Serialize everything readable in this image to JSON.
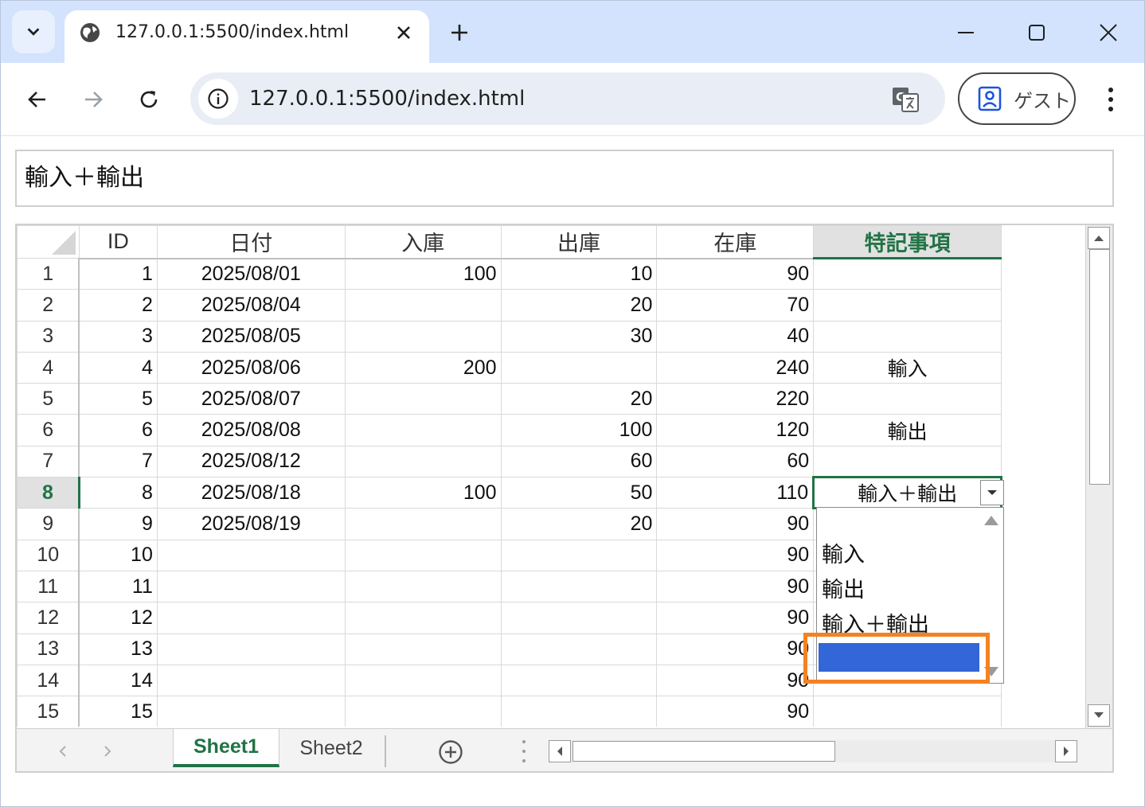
{
  "browser": {
    "tab_title": "127.0.0.1:5500/index.html",
    "url": "127.0.0.1:5500/index.html",
    "profile_label": "ゲスト"
  },
  "formula_bar": {
    "value": "輸入＋輸出"
  },
  "sheet": {
    "columns": [
      "ID",
      "日付",
      "入庫",
      "出庫",
      "在庫",
      "特記事項"
    ],
    "active_column": "特記事項",
    "active_row": "8",
    "rows": [
      {
        "row": "1",
        "id": "1",
        "date": "2025/08/01",
        "in": "100",
        "out": "10",
        "stock": "90",
        "note": ""
      },
      {
        "row": "2",
        "id": "2",
        "date": "2025/08/04",
        "in": "",
        "out": "20",
        "stock": "70",
        "note": ""
      },
      {
        "row": "3",
        "id": "3",
        "date": "2025/08/05",
        "in": "",
        "out": "30",
        "stock": "40",
        "note": ""
      },
      {
        "row": "4",
        "id": "4",
        "date": "2025/08/06",
        "in": "200",
        "out": "",
        "stock": "240",
        "note": "輸入"
      },
      {
        "row": "5",
        "id": "5",
        "date": "2025/08/07",
        "in": "",
        "out": "20",
        "stock": "220",
        "note": ""
      },
      {
        "row": "6",
        "id": "6",
        "date": "2025/08/08",
        "in": "",
        "out": "100",
        "stock": "120",
        "note": "輸出"
      },
      {
        "row": "7",
        "id": "7",
        "date": "2025/08/12",
        "in": "",
        "out": "60",
        "stock": "60",
        "note": ""
      },
      {
        "row": "8",
        "id": "8",
        "date": "2025/08/18",
        "in": "100",
        "out": "50",
        "stock": "110",
        "note": "輸入＋輸出"
      },
      {
        "row": "9",
        "id": "9",
        "date": "2025/08/19",
        "in": "",
        "out": "20",
        "stock": "90",
        "note": ""
      },
      {
        "row": "10",
        "id": "10",
        "date": "",
        "in": "",
        "out": "",
        "stock": "90",
        "note": ""
      },
      {
        "row": "11",
        "id": "11",
        "date": "",
        "in": "",
        "out": "",
        "stock": "90",
        "note": ""
      },
      {
        "row": "12",
        "id": "12",
        "date": "",
        "in": "",
        "out": "",
        "stock": "90",
        "note": ""
      },
      {
        "row": "13",
        "id": "13",
        "date": "",
        "in": "",
        "out": "",
        "stock": "90",
        "note": ""
      },
      {
        "row": "14",
        "id": "14",
        "date": "",
        "in": "",
        "out": "",
        "stock": "90",
        "note": ""
      },
      {
        "row": "15",
        "id": "15",
        "date": "",
        "in": "",
        "out": "",
        "stock": "90",
        "note": ""
      }
    ]
  },
  "dropdown": {
    "options": [
      "輸入",
      "輸出",
      "輸入＋輸出",
      ""
    ],
    "selected_index": 3
  },
  "sheet_tabs": [
    "Sheet1",
    "Sheet2"
  ],
  "active_sheet": "Sheet1",
  "colors": {
    "accent_green": "#217346",
    "selection_blue": "#3366d6",
    "highlight_orange": "#f58220",
    "chrome_blue": "#d3e3fd"
  }
}
